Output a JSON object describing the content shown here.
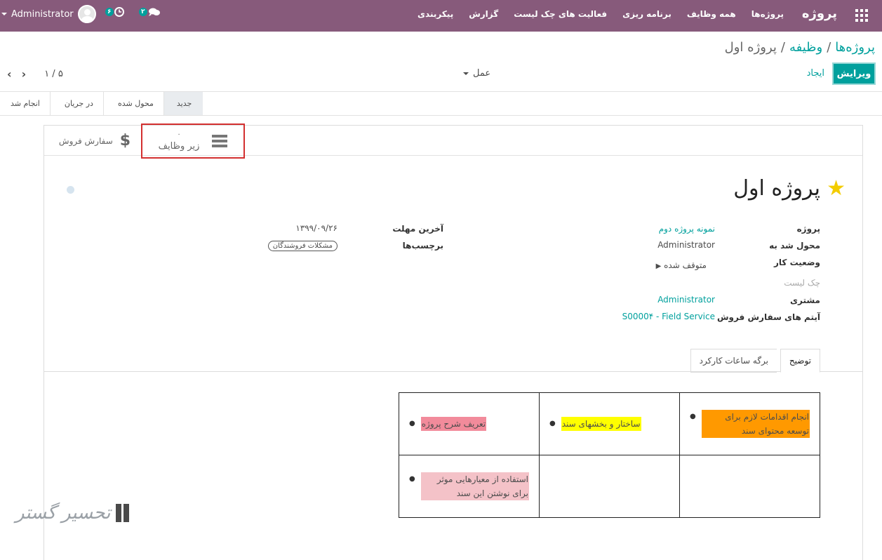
{
  "topbar": {
    "brand": "پروژه",
    "menu": [
      "پروژه‌ها",
      "همه وظایف",
      "برنامه ریزی",
      "فعالیت های چک لیست",
      "گزارش",
      "پیکربندی"
    ],
    "user": "Administrator",
    "activity_badge": "۶",
    "messages_badge": "۲"
  },
  "breadcrumb": {
    "projects": "پروژه‌ها",
    "task": "وظیفه",
    "current": "پروژه اول",
    "sep": "/"
  },
  "toolbar": {
    "edit": "ویرایش",
    "create": "ایجاد",
    "action": "عمل",
    "pager": "۱ / ۵"
  },
  "stages": [
    "جدید",
    "محول شده",
    "در جریان",
    "انجام شد"
  ],
  "smart_buttons": {
    "subtasks_count": "۰",
    "subtasks_label": "زیر وظایف",
    "sales_order": "سفارش فروش"
  },
  "record": {
    "title": "پروژه اول",
    "labels": {
      "project": "پروژه",
      "assigned_to": "محول شد به",
      "kanban_state": "وضعیت کار",
      "checklist": "چک لیست",
      "customer": "مشتری",
      "sale_line": "آیتم های سفارش فروش",
      "deadline": "آخرین مهلت",
      "tags": "برچسب‌ها"
    },
    "values": {
      "project": "نمونه پروژه دوم",
      "assigned_to": "Administrator",
      "kanban_state": "متوقف شده",
      "customer": "Administrator",
      "sale_line": "S0000۴ - Field Service",
      "deadline": "۱۳۹۹/۰۹/۲۶",
      "tag": "مشکلات فروشندگان"
    }
  },
  "tabs": {
    "description": "توضیح",
    "timesheets": "برگه ساعات کارکرد"
  },
  "description_table": {
    "r1c1": "تعریف شرح پروژه",
    "r1c2": "ساختار و بخشهای سند",
    "r1c3": "انجام اقدامات لازم برای توسعه محتوای سند",
    "r2c1": "استفاده از معیارهایی موثر برای نوشتن این سند"
  },
  "highlight_colors": {
    "pink": "#f28b9b",
    "yellow": "#ffff00",
    "orange": "#ff9900",
    "rose": "#f4c2c8"
  },
  "watermark": {
    "text": "تحسیر گستر"
  }
}
